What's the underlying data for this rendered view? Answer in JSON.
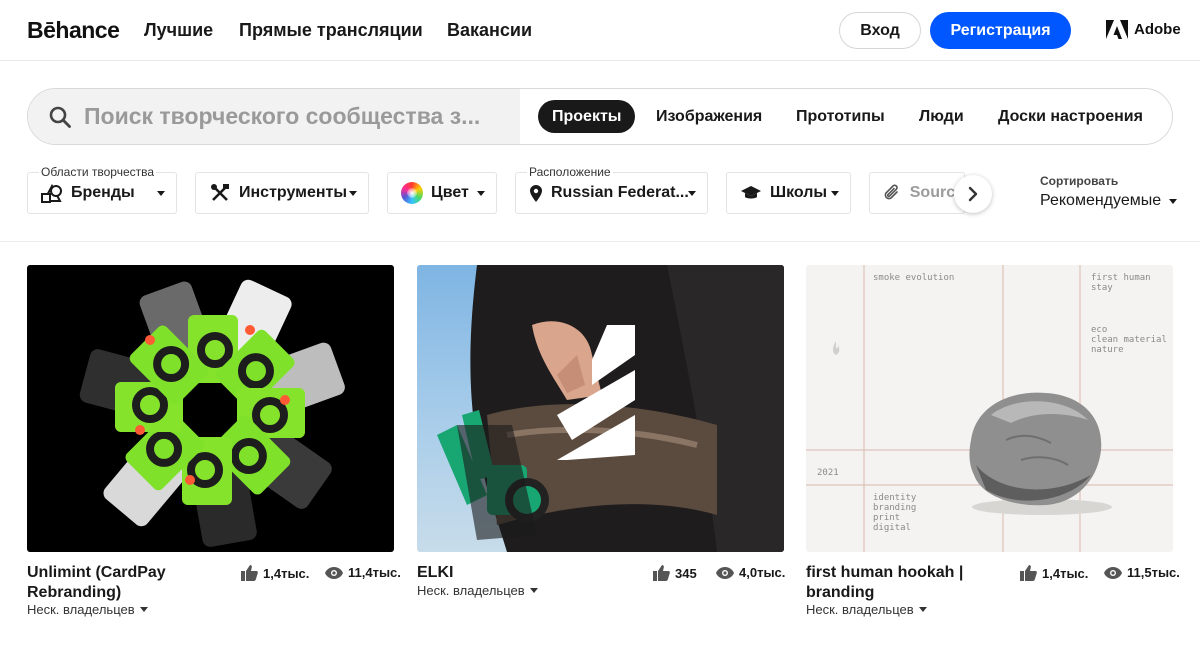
{
  "header": {
    "logo": "Bēhance",
    "nav": [
      "Лучшие",
      "Прямые трансляции",
      "Вакансии"
    ],
    "login": "Вход",
    "signup": "Регистрация",
    "adobe": "Adobe"
  },
  "search": {
    "placeholder": "Поиск творческого сообщества з...",
    "tabs": [
      "Проекты",
      "Изображения",
      "Прототипы",
      "Люди",
      "Доски настроения"
    ],
    "active_tab": "Проекты"
  },
  "filters": {
    "creative_fields_label": "Области творчества",
    "brands": "Бренды",
    "tools": "Инструменты",
    "color": "Цвет",
    "location_label": "Расположение",
    "location": "Russian Federat...",
    "schools": "Школы",
    "source": "Source",
    "sort_label": "Сортировать",
    "sort_value": "Рекомендуемые"
  },
  "cards": [
    {
      "title_line1": "Unlimint (CardPay",
      "title_line2": "Rebranding)",
      "likes": "1,4тыс.",
      "views": "11,4тыс.",
      "owners": "Неск. владельцев"
    },
    {
      "title_line1": "ELKI",
      "title_line2": "",
      "likes": "345",
      "views": "4,0тыс.",
      "owners": "Неск. владельцев"
    },
    {
      "title_line1": "first human hookah |",
      "title_line2": "branding",
      "likes": "1,4тыс.",
      "views": "11,5тыс.",
      "owners": "Неск. владельцев",
      "image_text": {
        "top_left": "smoke evolution",
        "top_right": "first human stay",
        "right_list": [
          "eco",
          "clean material",
          "nature"
        ],
        "year": "2021",
        "bottom_list": [
          "identity",
          "branding",
          "print",
          "digital"
        ]
      }
    }
  ],
  "colors": {
    "accent": "#0057ff",
    "dark": "#191919",
    "card_green": "#7fe12a"
  }
}
